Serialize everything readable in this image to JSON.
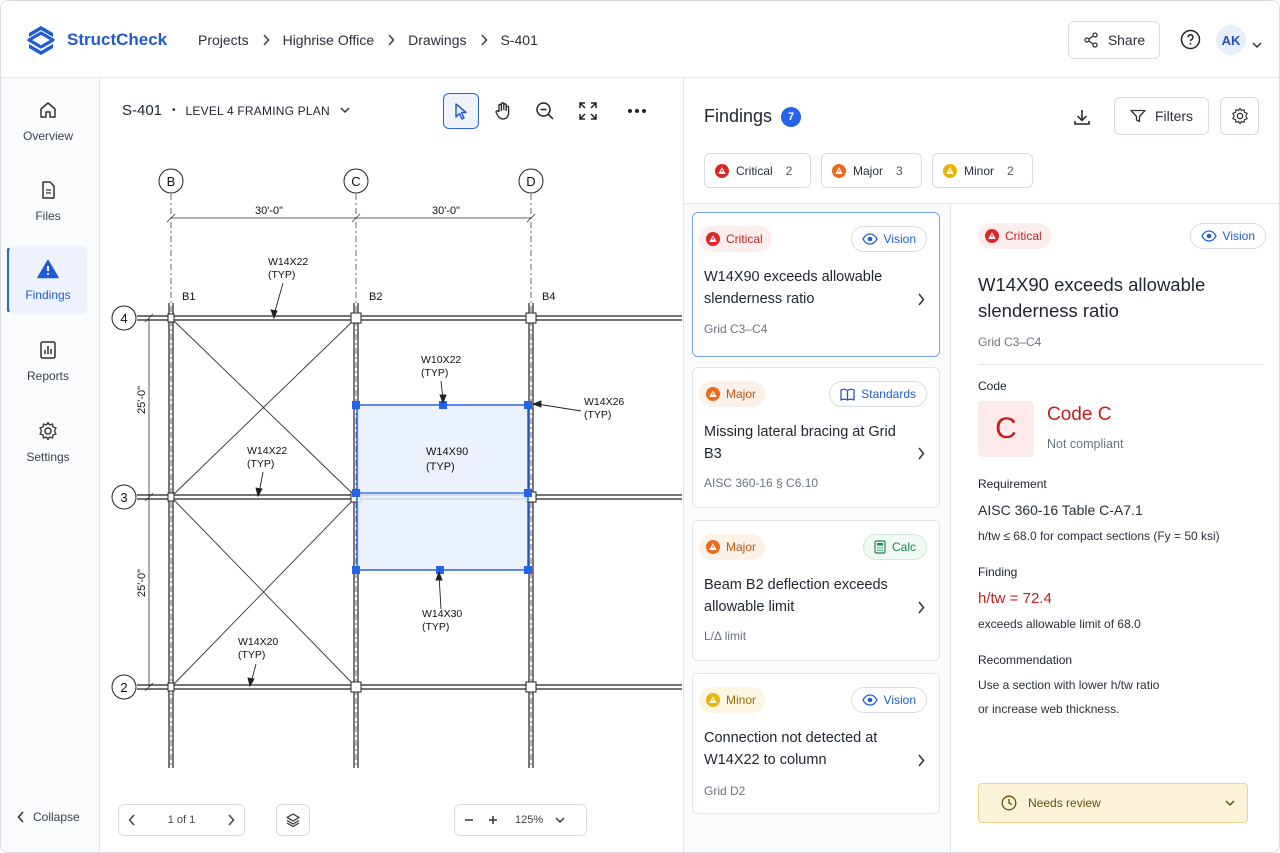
{
  "app": {
    "name": "StructCheck"
  },
  "breadcrumb": [
    "Projects",
    "Highrise Office",
    "Drawings",
    "S-401"
  ],
  "header": {
    "share_label": "Share",
    "avatar_initials": "AK"
  },
  "sidebar": {
    "items": [
      {
        "label": "Overview",
        "icon": "home-icon"
      },
      {
        "label": "Files",
        "icon": "file-icon"
      },
      {
        "label": "Findings",
        "icon": "warning-icon",
        "active": true
      },
      {
        "label": "Reports",
        "icon": "bar-chart-icon"
      },
      {
        "label": "Settings",
        "icon": "gear-icon"
      }
    ],
    "collapse_label": "Collapse"
  },
  "drawing": {
    "sheet": "S-401",
    "plan": "LEVEL 4 FRAMING PLAN",
    "tools": [
      "select-icon",
      "hand-icon",
      "zoom-out-icon",
      "fit-icon",
      "more-icon"
    ],
    "grid_cols": [
      "B",
      "C",
      "D"
    ],
    "grid_rows": [
      "4",
      "3",
      "2"
    ],
    "dim_h1": "30'-0\"",
    "dim_h2": "30'-0\"",
    "dim_v1": "25'-0\"",
    "dim_v2": "25'-0\"",
    "beam_labels": {
      "b1": "B1",
      "b2": "B2",
      "b4": "B4",
      "w14x22_top": "W14X22",
      "w14x22_mid": "W14X22",
      "w10x22": "W10X22",
      "w14x26": "W14X26",
      "w14x90": "W14X90",
      "w14x30": "W14X30",
      "w14x20": "W14X20",
      "typ": "(TYP)"
    },
    "pager": "1 of 1",
    "zoom": "125%"
  },
  "findings": {
    "title": "Findings",
    "count": "7",
    "filters_label": "Filters",
    "chips": [
      {
        "label": "Critical",
        "count": "2",
        "color": "#dc2626"
      },
      {
        "label": "Major",
        "count": "3",
        "color": "#ea6a1f"
      },
      {
        "label": "Minor",
        "count": "2",
        "color": "#eab308"
      }
    ],
    "cards": [
      {
        "severity": "Critical",
        "source": "Vision",
        "title": "W14X90 exceeds allowable slenderness ratio",
        "sub": "Grid C3–C4"
      },
      {
        "severity": "Major",
        "source": "Standards",
        "title": "Missing lateral bracing at Grid B3",
        "sub": "AISC 360-16   § C6.10"
      },
      {
        "severity": "Major",
        "source": "Calc",
        "title": "Beam B2 deflection exceeds allowable limit",
        "sub": "L/Δ limit"
      },
      {
        "severity": "Minor",
        "source": "Vision",
        "title": "Connection not detected at W14X22 to column",
        "sub": "Grid D2"
      }
    ],
    "detail": {
      "severity": "Critical",
      "source": "Vision",
      "title": "W14X90 exceeds allowable slenderness ratio",
      "grid": "Grid C3–C4",
      "code_label": "Code",
      "code_letter": "C",
      "code_title": "Code C",
      "code_status": "Not compliant",
      "requirement_label": "Requirement",
      "requirement_title": "AISC 360-16 Table C-A7.1",
      "requirement_text": "h/tw ≤ 68.0 for compact sections (Fy = 50 ksi)",
      "finding_label": "Finding",
      "finding_value": "h/tw = 72.4",
      "finding_text": "exceeds allowable limit of 68.0",
      "recommendation_label": "Recommendation",
      "recommendation_line1": "Use a section with lower h/tw ratio",
      "recommendation_line2": "or increase web thickness.",
      "status": "Needs review"
    }
  }
}
